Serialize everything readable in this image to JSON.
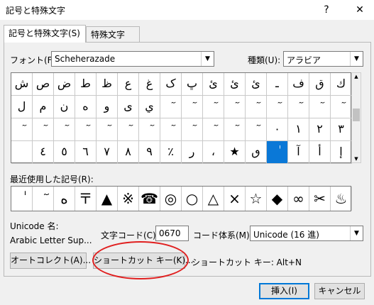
{
  "window": {
    "title": "記号と特殊文字",
    "help_glyph": "?",
    "close_glyph": "✕"
  },
  "tabs": [
    {
      "label": "記号と特殊文字(S)"
    },
    {
      "label": "特殊文字(P)"
    }
  ],
  "font": {
    "label": "フォント(F):",
    "value": "Scheherazade"
  },
  "kind": {
    "label": "種類(U):",
    "value": "アラビア"
  },
  "grid_rows": [
    [
      "ك",
      "ق",
      "ف",
      "ـ",
      "ئ",
      "ئ",
      "ئ",
      "ڀ",
      "ک",
      "غ",
      "ع",
      "ظ",
      "ط",
      "ض",
      "ص",
      "ش"
    ],
    [
      "َ",
      "ً",
      "ٌ",
      "ٍ",
      "ُ",
      "ِ",
      "ّ",
      "ْ",
      "ٓ",
      "ي",
      "ى",
      "و",
      "ه",
      "ن",
      "م",
      "ل"
    ],
    [
      "٣",
      "٢",
      "١",
      "٠",
      "ٖ",
      "ٗ",
      "٘",
      "ٙ",
      "ٚ",
      "ٛ",
      "ٜ",
      "ٝ",
      "ٞ",
      "ٟ",
      "٠",
      "ٕ"
    ],
    [
      "٤",
      "٥",
      "٦",
      "٧",
      "٨",
      "٩",
      "٪",
      "٫",
      "٬",
      "٭",
      "ٮ",
      "ٯ",
      "ٰ",
      "ٱ",
      "ٲ",
      "ٳ"
    ]
  ],
  "grid_display": [
    [
      "ك",
      "ق",
      "ف",
      "ـ",
      "ئ",
      "ئ",
      "ئ",
      "ڀ",
      "ک",
      "غ",
      "ع",
      "ظ",
      "ط",
      "ض",
      "ص",
      "ش"
    ],
    [
      "ٓ",
      "ٓ",
      "ٓ",
      "ٓ",
      "ٓ",
      "ٓ",
      "ٓ",
      "ٓ",
      "ٓ",
      "ي",
      "ى",
      "و",
      "ه",
      "ن",
      "م",
      "ل"
    ],
    [
      "٣",
      "٢",
      "١",
      "٠",
      "ٓ",
      "ٓ",
      "ٓ",
      "ٓ",
      "ٓ",
      "ٓ",
      "ٓ",
      "ٓ",
      "ٓ",
      "ٓ",
      "ٓ",
      "ٓ"
    ],
    [
      "إ",
      "أ",
      "آ",
      "ٰ",
      "ٯ",
      "★",
      "،",
      "ر",
      "٪",
      "٩",
      "٨",
      "٧",
      "٦",
      "٥",
      "٤"
    ]
  ],
  "recent_label": "最近使用した記号(R):",
  "recent": [
    "ٰ",
    "ٓ",
    "ه",
    "〒",
    "▲",
    "※",
    "☎",
    "◎",
    "○",
    "△",
    "×",
    "☆",
    "◆",
    "∞",
    "✂",
    "♨"
  ],
  "unicode_name_label": "Unicode 名:",
  "unicode_name": "Arabic Letter Sup...",
  "char_code": {
    "label": "文字コード(C):",
    "value": "0670"
  },
  "code_system": {
    "label": "コード体系(M):",
    "value": "Unicode (16 進)"
  },
  "autocorrect_button": "オートコレクト(A)...",
  "shortcut_button": "ショートカット キー(K)...",
  "shortcut_text": "ショートカット キー: Alt+N",
  "insert_button": "挿入(I)",
  "cancel_button": "キャンセル",
  "colors": {
    "accent": "#0078d7",
    "selection": "#0a78d7",
    "highlight_ellipse": "#e02020"
  }
}
